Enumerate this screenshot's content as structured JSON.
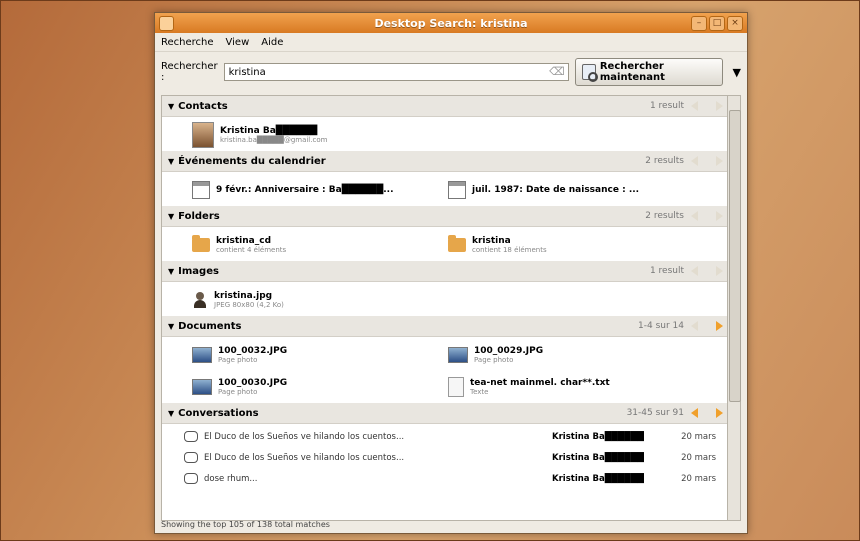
{
  "window": {
    "title": "Desktop Search: kristina"
  },
  "menu": [
    "Recherche",
    "View",
    "Aide"
  ],
  "search": {
    "label": "Rechercher :",
    "value": "kristina",
    "button": "Rechercher maintenant"
  },
  "categories": [
    {
      "name": "Contacts",
      "count": "1 result",
      "items": [
        {
          "title": "Kristina Ba██████",
          "sub": "kristina.ba█████@gmail.com",
          "icon": "contact-photo-icon"
        }
      ]
    },
    {
      "name": "Événements du calendrier",
      "count": "2 results",
      "items": [
        {
          "title": "9 févr.: Anniversaire : Ba██████...",
          "sub": "",
          "icon": "calendar-icon"
        },
        {
          "title": "juil. 1987: Date de naissance : ...",
          "sub": "",
          "icon": "calendar-icon"
        }
      ]
    },
    {
      "name": "Folders",
      "count": "2 results",
      "items": [
        {
          "title": "kristina_cd",
          "sub": "contient 4 éléments",
          "icon": "folder-icon"
        },
        {
          "title": "kristina",
          "sub": "contient 18 éléments",
          "icon": "folder-icon"
        }
      ]
    },
    {
      "name": "Images",
      "count": "1 result",
      "items": [
        {
          "title": "kristina.jpg",
          "sub": "JPEG 80x80 (4,2 Ko)",
          "icon": "person-image-icon"
        }
      ]
    },
    {
      "name": "Documents",
      "count": "1-4 sur 14",
      "items": [
        {
          "title": "100_0032.JPG",
          "sub": "Page photo",
          "icon": "image-file-icon"
        },
        {
          "title": "100_0029.JPG",
          "sub": "Page photo",
          "icon": "image-file-icon"
        },
        {
          "title": "100_0030.JPG",
          "sub": "Page photo",
          "icon": "image-file-icon"
        },
        {
          "title": "tea-net mainmel. char**.txt",
          "sub": "Texte",
          "icon": "text-file-icon"
        }
      ]
    },
    {
      "name": "Conversations",
      "count": "31-45 sur 91",
      "items": []
    }
  ],
  "conversations": [
    {
      "subject": "El Duco de los Sueños ve hilando los cuentos...",
      "from": "Kristina Ba██████",
      "date": "20 mars"
    },
    {
      "subject": "El Duco de los Sueños ve hilando los cuentos...",
      "from": "Kristina Ba██████",
      "date": "20 mars"
    },
    {
      "subject": "dose rhum...",
      "from": "Kristina Ba██████",
      "date": "20 mars"
    }
  ],
  "status": "Showing the top 105 of 138 total matches"
}
